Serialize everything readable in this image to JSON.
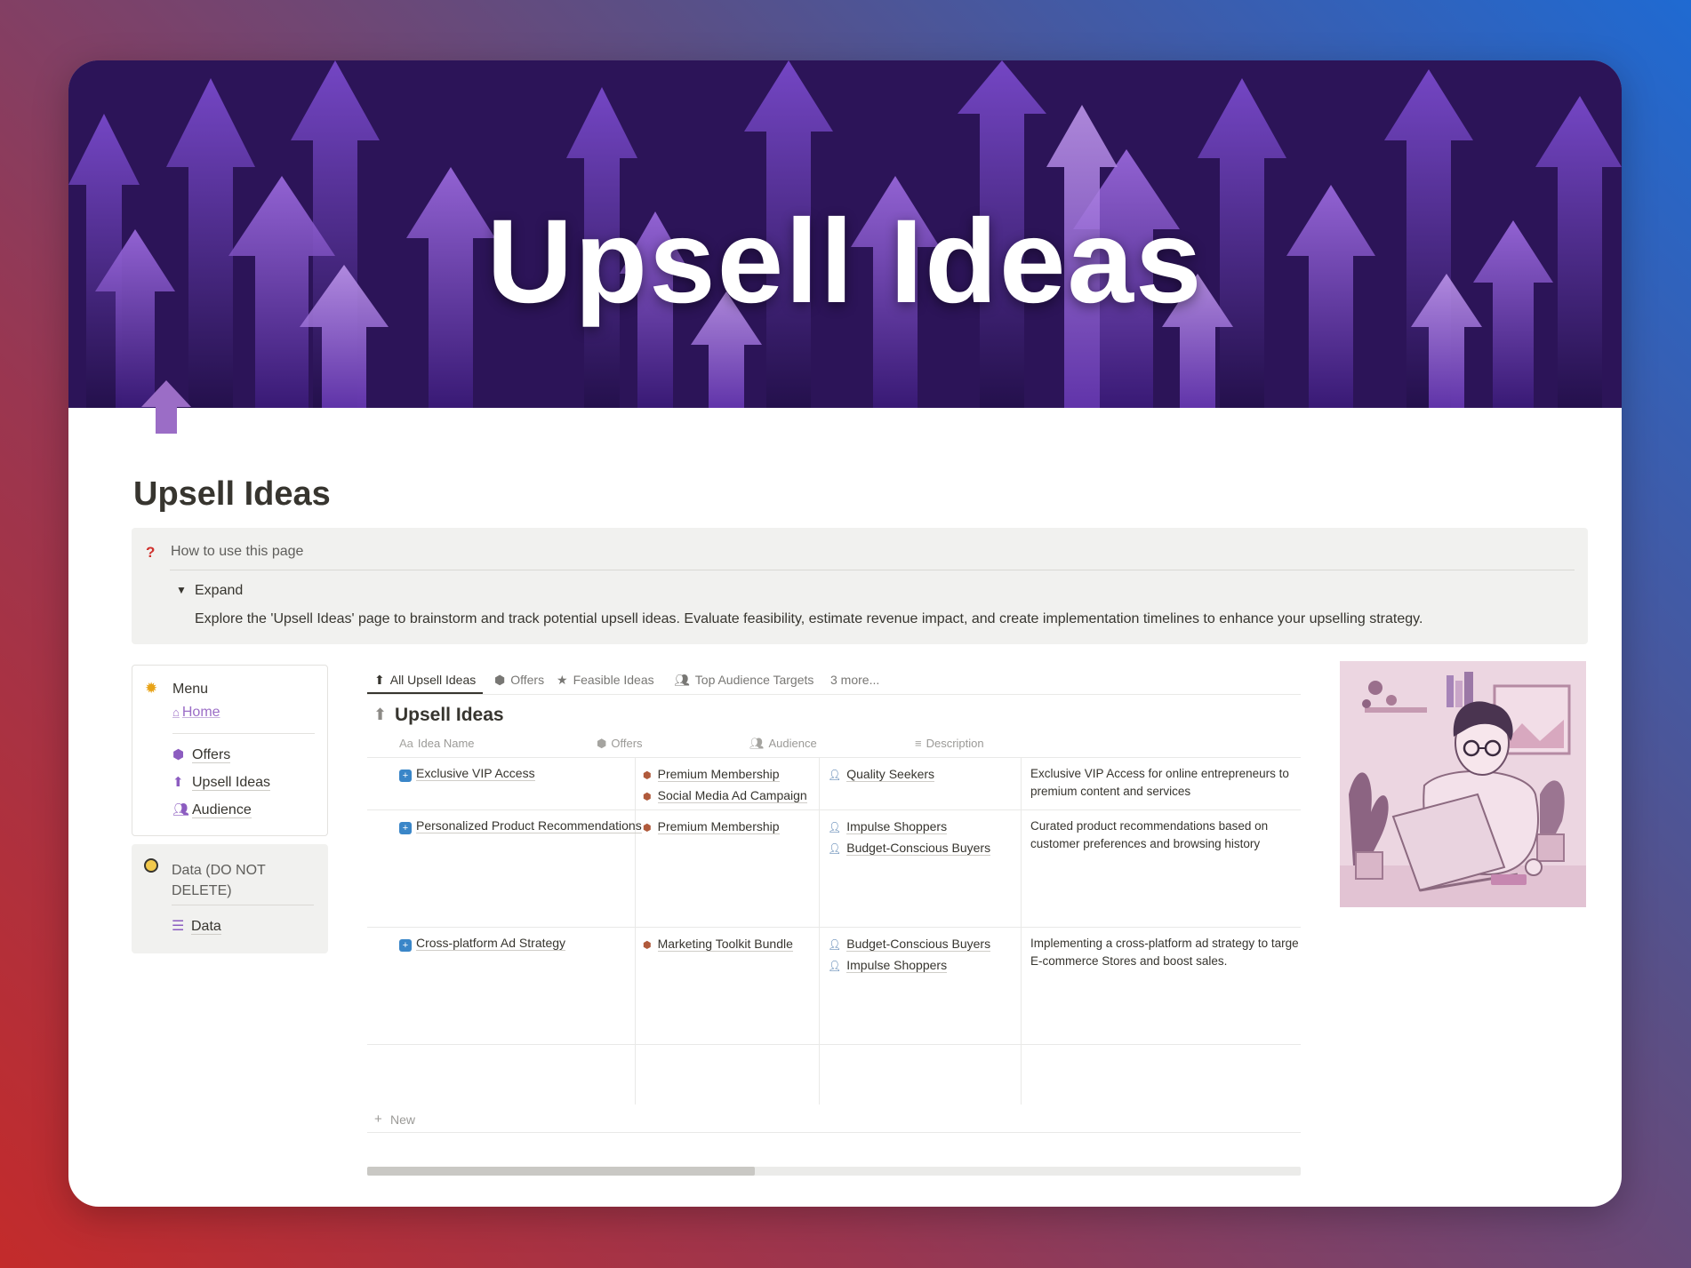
{
  "cover": {
    "title": "Upsell Ideas"
  },
  "page": {
    "title": "Upsell Ideas"
  },
  "callout": {
    "heading": "How to use this page",
    "toggle_label": "Expand",
    "body": "Explore the 'Upsell Ideas' page to brainstorm and track potential upsell ideas. Evaluate feasibility, estimate revenue impact, and create implementation timelines to enhance your upselling strategy."
  },
  "menu": {
    "title": "Menu",
    "home_label": "Home",
    "items": [
      {
        "label": "Offers",
        "icon": "cube-icon"
      },
      {
        "label": "Upsell Ideas",
        "icon": "arrow-up-icon"
      },
      {
        "label": "Audience",
        "icon": "people-icon"
      }
    ]
  },
  "data_section": {
    "title": "Data (DO NOT DELETE)",
    "item_label": "Data"
  },
  "tabs": [
    {
      "label": "All Upsell Ideas",
      "icon": "arrow-up-icon",
      "active": true
    },
    {
      "label": "Offers",
      "icon": "cube-icon"
    },
    {
      "label": "Feasible Ideas",
      "icon": "star-icon"
    },
    {
      "label": "Top Audience Targets",
      "icon": "people-icon"
    },
    {
      "label": "3 more..."
    }
  ],
  "database": {
    "title": "Upsell Ideas",
    "columns": [
      {
        "label": "Idea Name",
        "icon": "Aa"
      },
      {
        "label": "Offers",
        "icon": "cube-icon"
      },
      {
        "label": "Audience",
        "icon": "people-icon"
      },
      {
        "label": "Description",
        "icon": "text-icon"
      }
    ],
    "rows": [
      {
        "name": "Exclusive VIP Access",
        "offers": [
          "Premium Membership",
          "Social Media Ad Campaign"
        ],
        "audience": [
          "Quality Seekers"
        ],
        "description": "Exclusive VIP Access for online entrepreneurs to premium content and services"
      },
      {
        "name": "Personalized Product Recommendations",
        "offers": [
          "Premium Membership"
        ],
        "audience": [
          "Impulse Shoppers",
          "Budget-Conscious Buyers"
        ],
        "description": "Curated product recommendations based on customer preferences and browsing history"
      },
      {
        "name": "Cross-platform Ad Strategy",
        "offers": [
          "Marketing Toolkit Bundle"
        ],
        "audience": [
          "Budget-Conscious Buyers",
          "Impulse Shoppers"
        ],
        "description_line1": "Implementing a cross-platform ad strategy to targe",
        "description_line2": "E-commerce Stores and boost sales."
      }
    ],
    "new_label": "New"
  },
  "colors": {
    "accent": "#8c5cc0",
    "cover_dark": "#2a1254",
    "callout_bg": "#f1f1ef"
  }
}
